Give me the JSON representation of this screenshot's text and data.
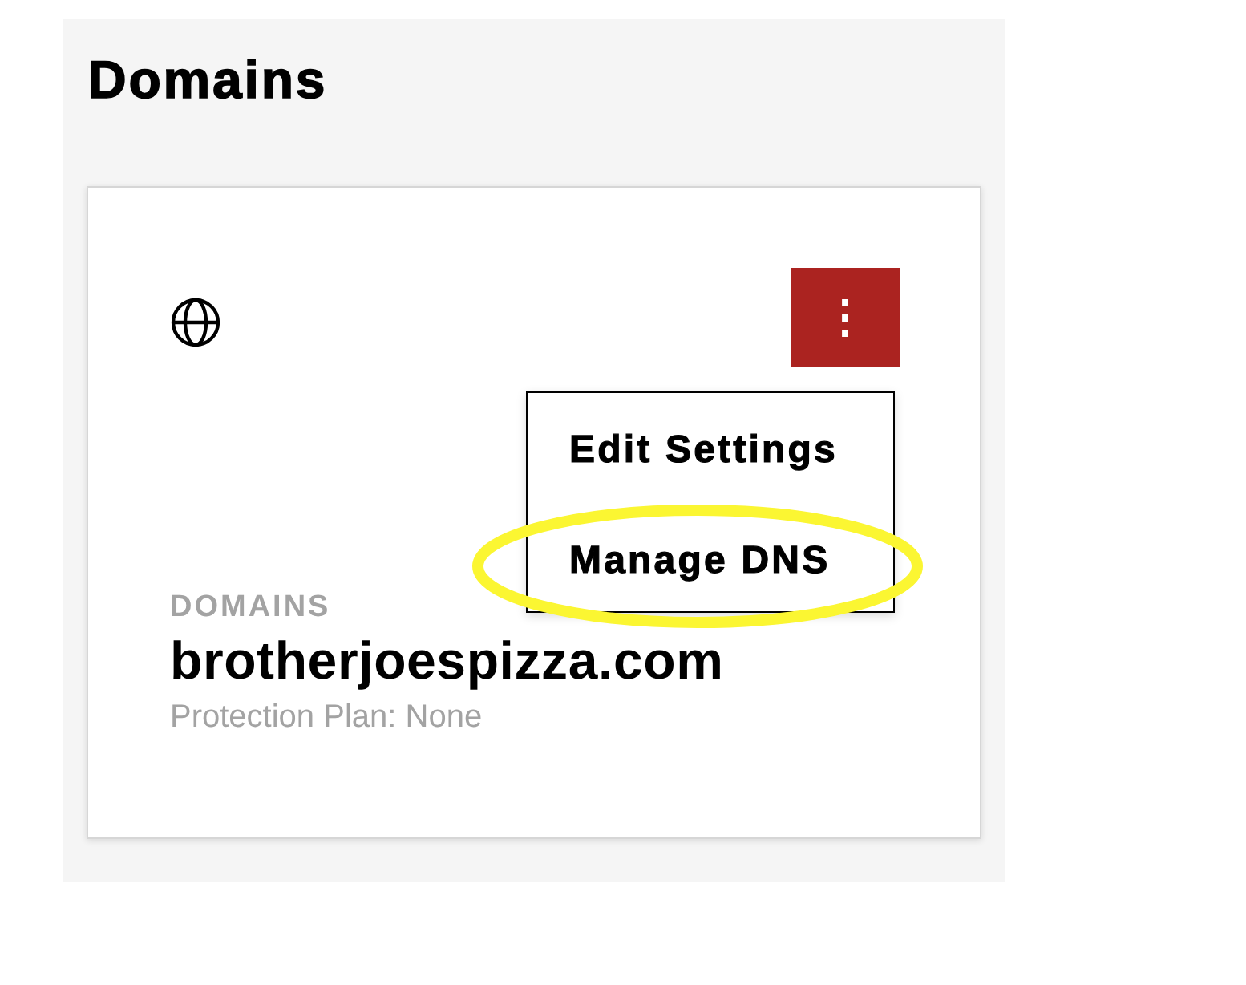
{
  "page": {
    "title": "Domains"
  },
  "card": {
    "category": "DOMAINS",
    "domain": "brotherjoespizza.com",
    "protection": "Protection Plan: None",
    "menu_button": {
      "label": "⋮"
    },
    "menu": [
      {
        "label": "Edit Settings",
        "highlighted": false
      },
      {
        "label": "Manage DNS",
        "highlighted": true
      }
    ]
  }
}
